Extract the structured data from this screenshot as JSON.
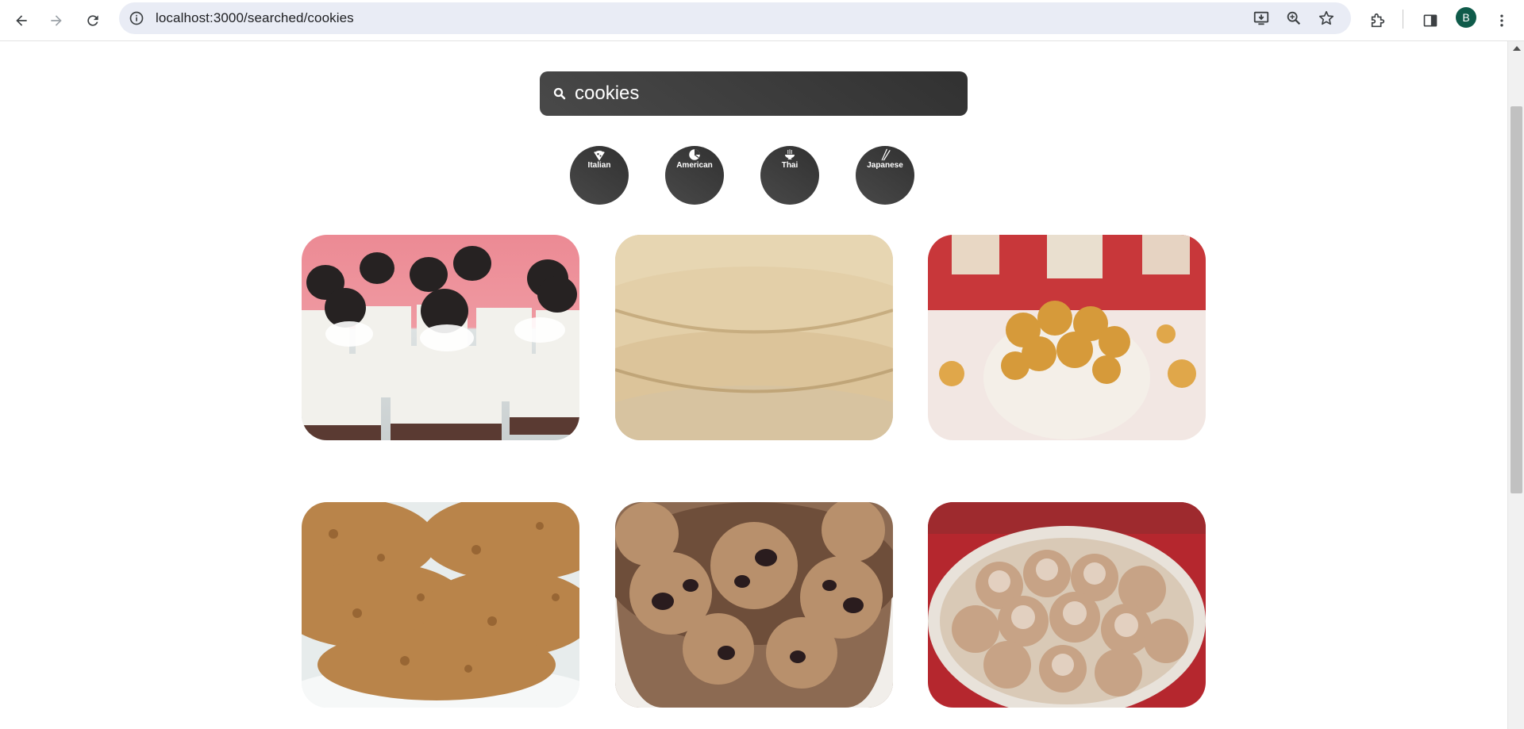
{
  "browser": {
    "url": "localhost:3000/searched/cookies",
    "avatar_letter": "B"
  },
  "search": {
    "value": "cookies"
  },
  "cuisines": [
    {
      "label": "Italian",
      "icon": "pizza-icon"
    },
    {
      "label": "American",
      "icon": "hamburger-icon"
    },
    {
      "label": "Thai",
      "icon": "noodle-bowl-icon"
    },
    {
      "label": "Japanese",
      "icon": "chopsticks-icon"
    }
  ],
  "results": [
    {
      "image": "oreo-cheesecake-photo"
    },
    {
      "image": "sugar-cookies-photo"
    },
    {
      "image": "peanut-cookies-bowl-photo"
    },
    {
      "image": "oatmeal-cookies-photo"
    },
    {
      "image": "raisin-cookie-balls-photo"
    },
    {
      "image": "powdered-cookies-bowl-photo"
    }
  ]
}
